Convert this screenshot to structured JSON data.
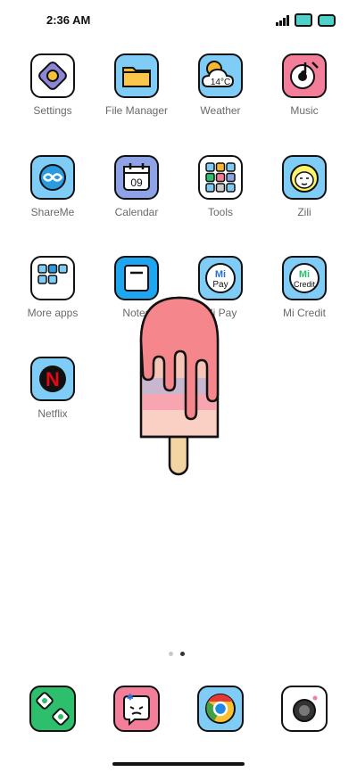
{
  "status": {
    "time": "2:36 AM"
  },
  "apps": [
    {
      "label": "Settings"
    },
    {
      "label": "File Manager"
    },
    {
      "label": "Weather",
      "temp": "14°C"
    },
    {
      "label": "Music"
    },
    {
      "label": "ShareMe"
    },
    {
      "label": "Calendar",
      "date": "09"
    },
    {
      "label": "Tools"
    },
    {
      "label": "Zili"
    },
    {
      "label": "More apps"
    },
    {
      "label": "Notes"
    },
    {
      "label": "Mi Pay",
      "icon_line1": "Mi",
      "icon_line2": "Pay"
    },
    {
      "label": "Mi Credit",
      "icon_line1": "Mi",
      "icon_line2": "Credit"
    },
    {
      "label": "Netflix",
      "icon_text": "N"
    }
  ],
  "page_indicator": {
    "count": 2,
    "active_index": 1
  },
  "dock": [
    {
      "name": "phone",
      "icon": "phone-icon"
    },
    {
      "name": "messages",
      "icon": "messages-icon"
    },
    {
      "name": "chrome",
      "icon": "chrome-icon"
    },
    {
      "name": "camera",
      "icon": "camera-icon"
    }
  ],
  "colors": {
    "sky": "#7fcdf6",
    "pink": "#f37e9a",
    "green": "#2dbf6b",
    "red": "#e50914",
    "popsicle_top": "#f4868c"
  }
}
